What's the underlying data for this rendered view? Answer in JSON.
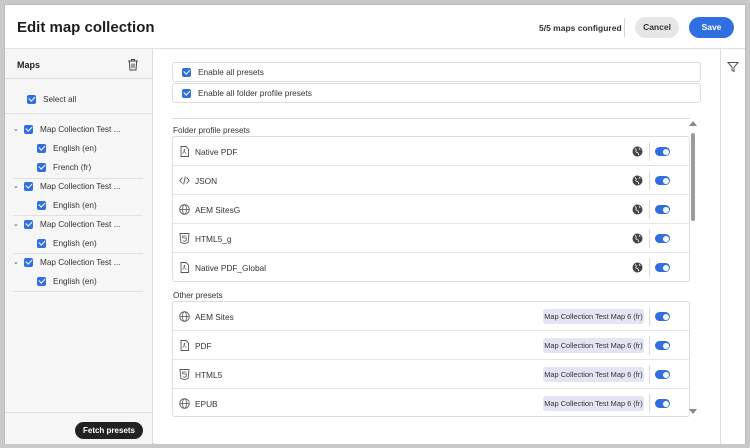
{
  "header": {
    "title": "Edit map collection",
    "configured": "5/5 maps configured",
    "cancel_label": "Cancel",
    "save_label": "Save"
  },
  "sidebar": {
    "title": "Maps",
    "select_all": "Select all",
    "collections": [
      {
        "label": "Map Collection Test ...",
        "items": [
          "English (en)",
          "French (fr)"
        ]
      },
      {
        "label": "Map Collection Test ...",
        "items": [
          "English (en)"
        ]
      },
      {
        "label": "Map Collection Test ...",
        "items": [
          "English (en)"
        ]
      },
      {
        "label": "Map Collection Test ...",
        "items": [
          "English (en)"
        ]
      }
    ],
    "fetch_label": "Fetch presets"
  },
  "main": {
    "enable_all": "Enable all presets",
    "enable_folder": "Enable all folder profile presets",
    "folder_section": "Folder profile presets",
    "folder_presets": [
      {
        "name": "Native PDF",
        "icon": "pdf-icon"
      },
      {
        "name": "JSON",
        "icon": "code-icon"
      },
      {
        "name": "AEM SitesG",
        "icon": "globe-icon"
      },
      {
        "name": "HTML5_g",
        "icon": "html5-icon"
      },
      {
        "name": "Native PDF_Global",
        "icon": "pdf-icon"
      }
    ],
    "other_section": "Other presets",
    "other_presets": [
      {
        "name": "AEM Sites",
        "icon": "globe-icon",
        "tag": "Map Collection Test Map 6 (fr)"
      },
      {
        "name": "PDF",
        "icon": "pdf-icon",
        "tag": "Map Collection Test Map 6 (fr)"
      },
      {
        "name": "HTML5",
        "icon": "html5-icon",
        "tag": "Map Collection Test Map 6 (fr)"
      },
      {
        "name": "EPUB",
        "icon": "globe-icon",
        "tag": "Map Collection Test Map 6 (fr)"
      }
    ]
  },
  "colors": {
    "accent": "#2f6fe0",
    "tag_bg": "#e3e4f4"
  }
}
